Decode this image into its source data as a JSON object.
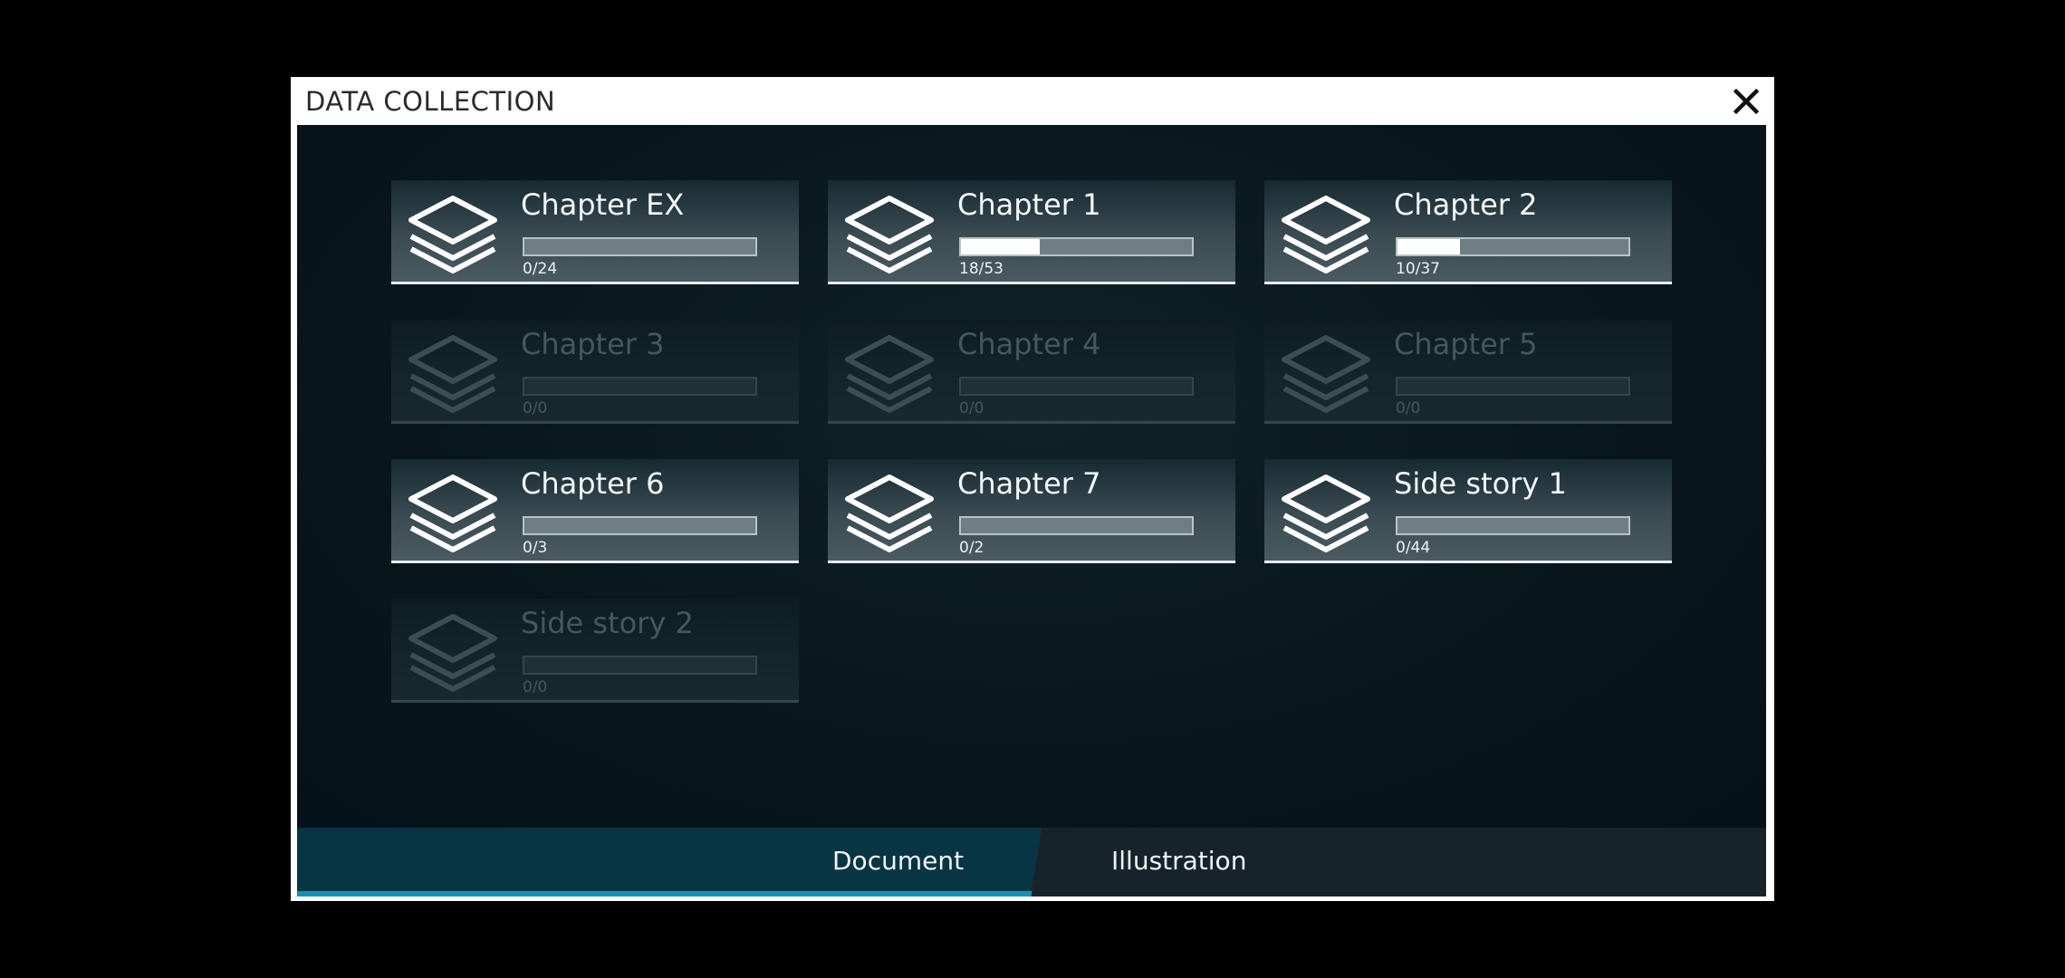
{
  "dialog": {
    "title": "DATA COLLECTION",
    "close_icon": "close-icon"
  },
  "chapters": [
    {
      "name": "Chapter EX",
      "count": "0/24",
      "progress": 0,
      "locked": false
    },
    {
      "name": "Chapter 1",
      "count": "18/53",
      "progress": 0.34,
      "locked": false
    },
    {
      "name": "Chapter 2",
      "count": "10/37",
      "progress": 0.27,
      "locked": false
    },
    {
      "name": "Chapter 3",
      "count": "0/0",
      "progress": 0,
      "locked": true
    },
    {
      "name": "Chapter 4",
      "count": "0/0",
      "progress": 0,
      "locked": true
    },
    {
      "name": "Chapter 5",
      "count": "0/0",
      "progress": 0,
      "locked": true
    },
    {
      "name": "Chapter 6",
      "count": "0/3",
      "progress": 0,
      "locked": false
    },
    {
      "name": "Chapter 7",
      "count": "0/2",
      "progress": 0,
      "locked": false
    },
    {
      "name": "Side story 1",
      "count": "0/44",
      "progress": 0,
      "locked": false
    },
    {
      "name": "Side story 2",
      "count": "0/0",
      "progress": 0,
      "locked": true
    }
  ],
  "chapter_icon": "layers-icon",
  "tabs": {
    "document": "Document",
    "illustration": "Illustration",
    "active": "document"
  },
  "colors": {
    "active_tab": "#073544",
    "active_tab_underline": "#1b8fb0"
  }
}
